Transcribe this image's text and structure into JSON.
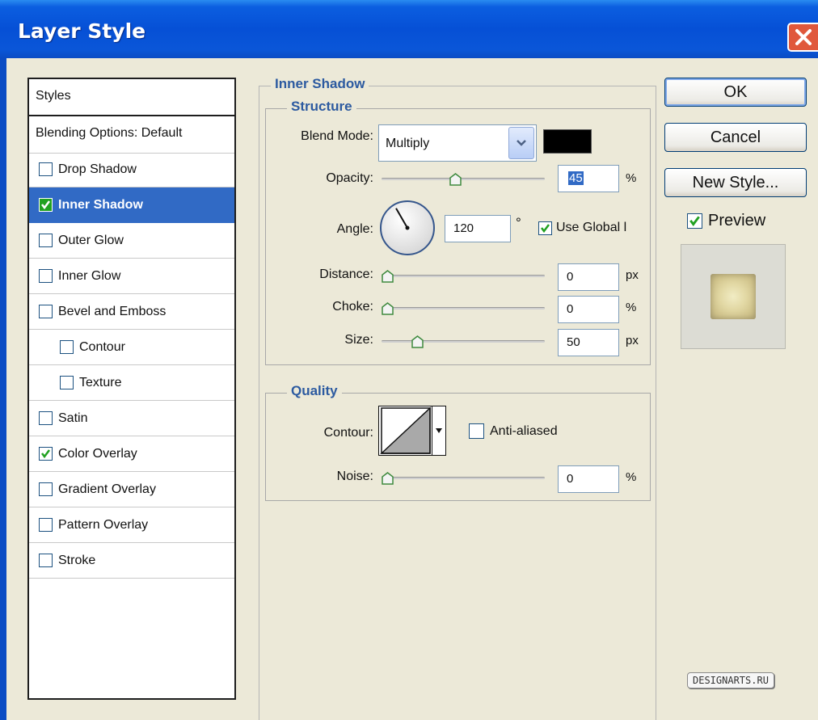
{
  "window": {
    "title": "Layer Style"
  },
  "styles_list": {
    "header": "Styles",
    "items": [
      {
        "label": "Blending Options: Default",
        "checked": null,
        "selected": false,
        "indent": 0
      },
      {
        "label": "Drop Shadow",
        "checked": false,
        "selected": false,
        "indent": 0
      },
      {
        "label": "Inner Shadow",
        "checked": true,
        "selected": true,
        "indent": 0
      },
      {
        "label": "Outer Glow",
        "checked": false,
        "selected": false,
        "indent": 0
      },
      {
        "label": "Inner Glow",
        "checked": false,
        "selected": false,
        "indent": 0
      },
      {
        "label": "Bevel and Emboss",
        "checked": false,
        "selected": false,
        "indent": 0
      },
      {
        "label": "Contour",
        "checked": false,
        "selected": false,
        "indent": 1
      },
      {
        "label": "Texture",
        "checked": false,
        "selected": false,
        "indent": 1
      },
      {
        "label": "Satin",
        "checked": false,
        "selected": false,
        "indent": 0
      },
      {
        "label": "Color Overlay",
        "checked": true,
        "selected": false,
        "indent": 0
      },
      {
        "label": "Gradient Overlay",
        "checked": false,
        "selected": false,
        "indent": 0
      },
      {
        "label": "Pattern Overlay",
        "checked": false,
        "selected": false,
        "indent": 0
      },
      {
        "label": "Stroke",
        "checked": false,
        "selected": false,
        "indent": 0
      }
    ]
  },
  "panel": {
    "title": "Inner Shadow",
    "structure": {
      "title": "Structure",
      "blend_mode": {
        "label": "Blend Mode:",
        "value": "Multiply",
        "color": "#000000"
      },
      "opacity": {
        "label": "Opacity:",
        "value": "45",
        "unit": "%",
        "fraction": 0.45
      },
      "angle": {
        "label": "Angle:",
        "value": "120",
        "unit": "°",
        "degrees": 120
      },
      "use_global": {
        "label": "Use Global l",
        "checked": true
      },
      "distance": {
        "label": "Distance:",
        "value": "0",
        "unit": "px",
        "fraction": 0
      },
      "choke": {
        "label": "Choke:",
        "value": "0",
        "unit": "%",
        "fraction": 0
      },
      "size": {
        "label": "Size:",
        "value": "50",
        "unit": "px",
        "fraction": 0.2
      }
    },
    "quality": {
      "title": "Quality",
      "contour_label": "Contour:",
      "anti_aliased": {
        "label": "Anti-aliased",
        "checked": false
      },
      "noise": {
        "label": "Noise:",
        "value": "0",
        "unit": "%",
        "fraction": 0
      }
    }
  },
  "buttons": {
    "ok": "OK",
    "cancel": "Cancel",
    "new_style": "New Style..."
  },
  "preview": {
    "label": "Preview",
    "checked": true
  },
  "watermark": "DESIGNARTS.RU",
  "colors": {
    "titlebar": "#0650d6",
    "client": "#ece9d8",
    "selection": "#316ac5",
    "group_title": "#2c5aa0",
    "checkmark": "#21a121"
  }
}
